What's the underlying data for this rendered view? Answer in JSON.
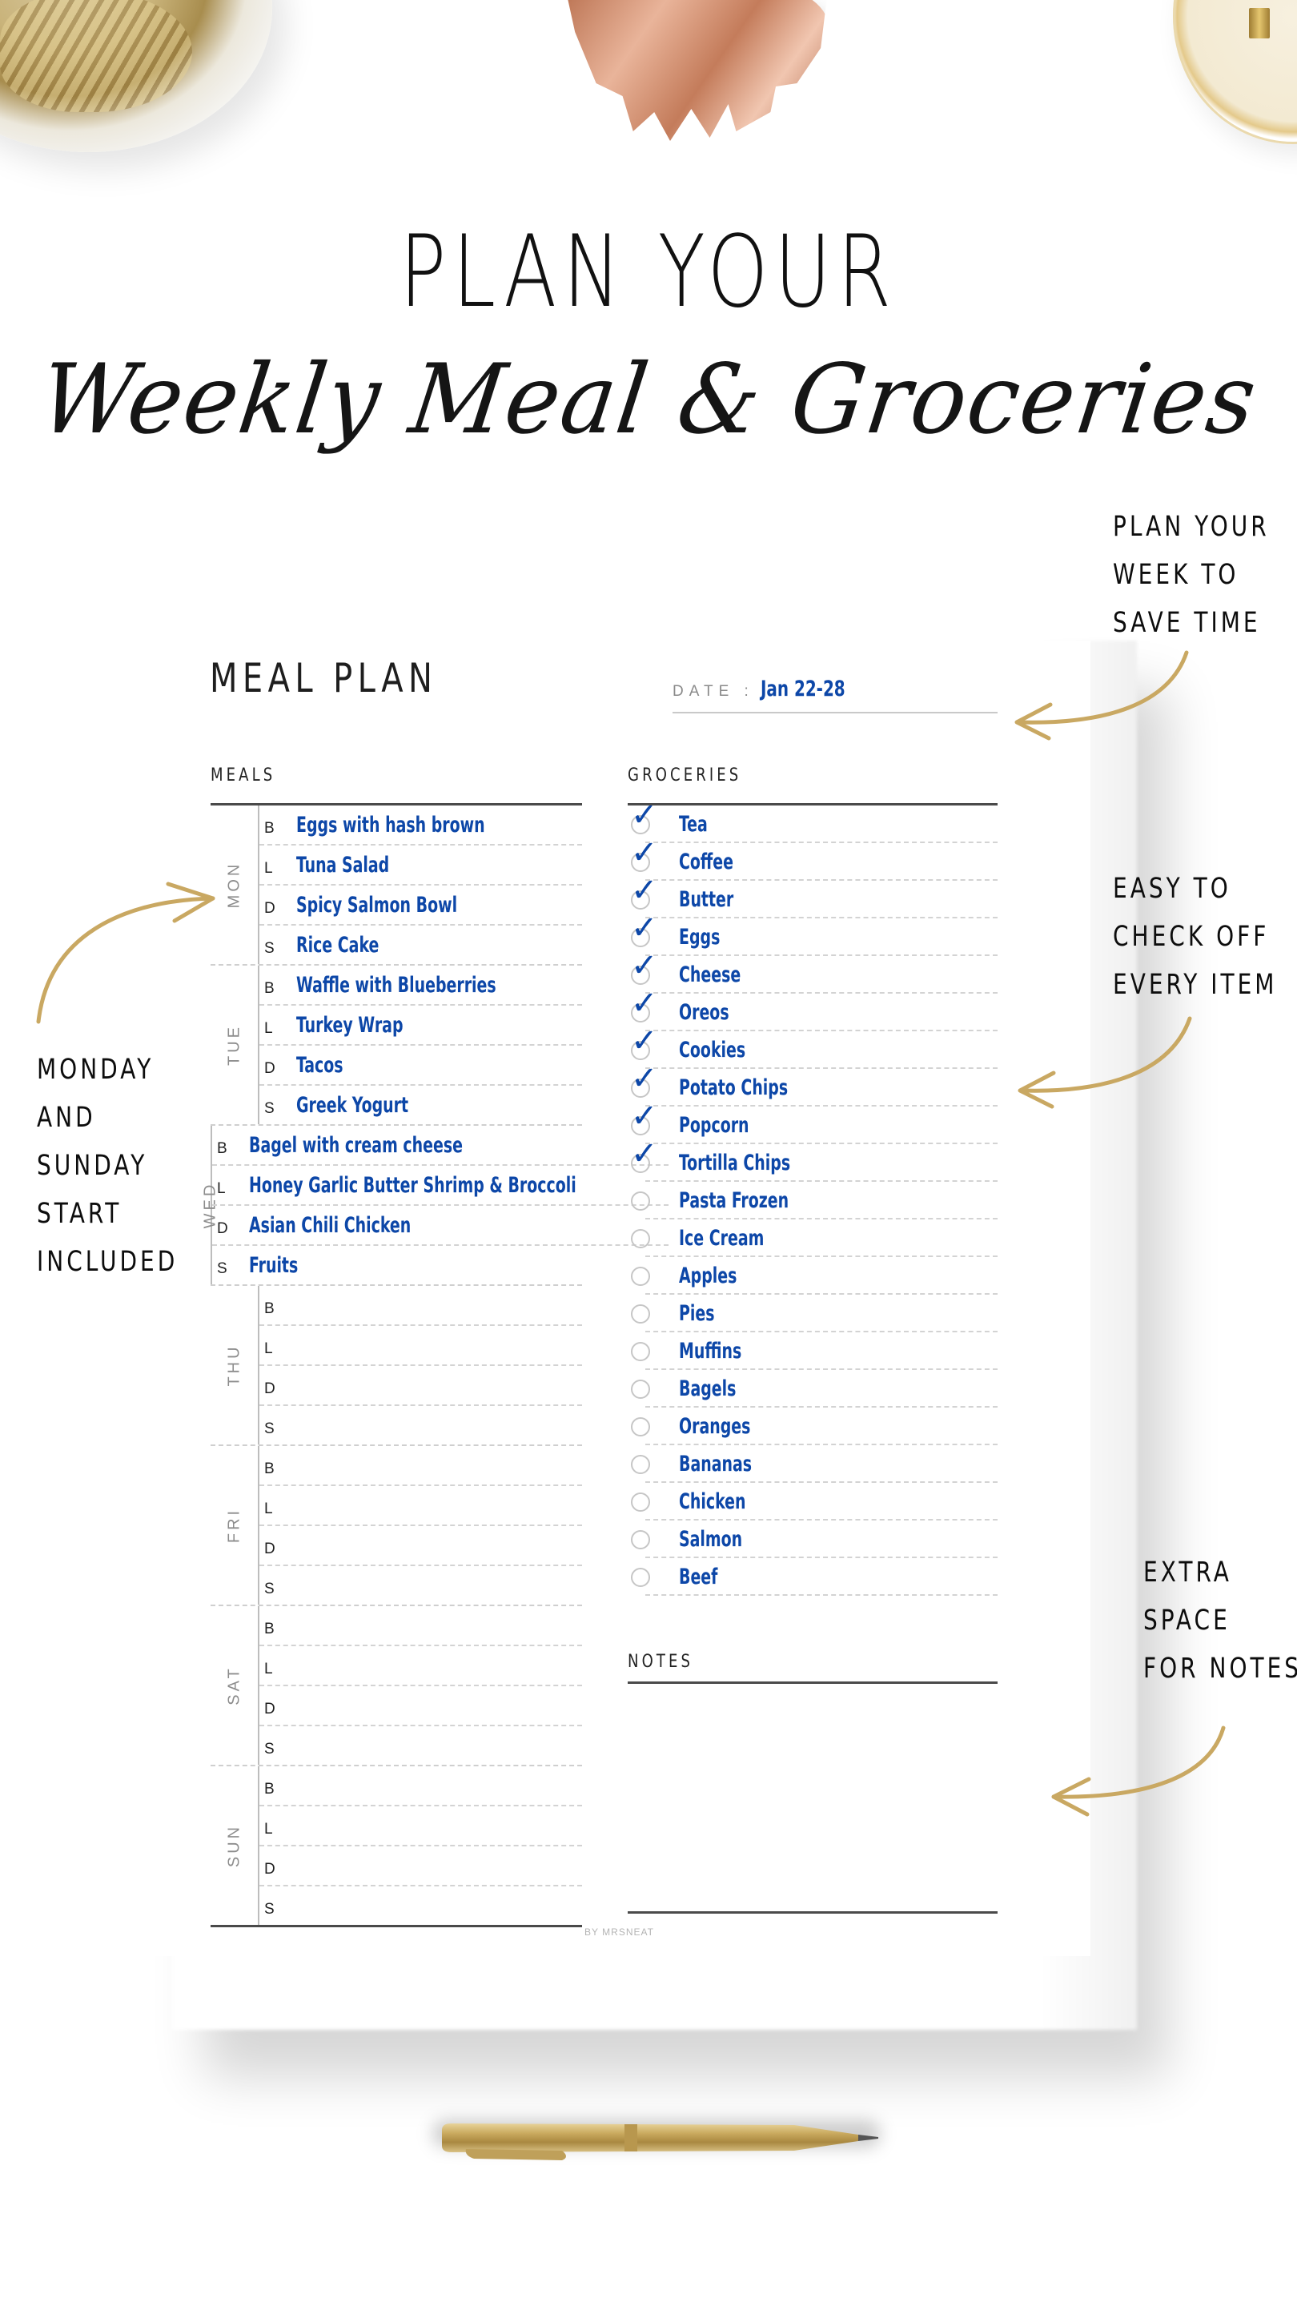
{
  "hero": {
    "title": "PLAN YOUR",
    "script_subtitle": "Weekly Meal & Groceries"
  },
  "planner": {
    "title": "MEAL PLAN",
    "date_label": "DATE :",
    "date_value": "Jan 22-28",
    "meals_label": "MEALS",
    "groceries_label": "GROCERIES",
    "notes_label": "NOTES",
    "credit": "BY MRSNEAT",
    "accent_color": "#0d47a8",
    "days": [
      {
        "day": "MON",
        "slots": [
          {
            "letter": "B",
            "meal": "Eggs with hash brown"
          },
          {
            "letter": "L",
            "meal": "Tuna Salad"
          },
          {
            "letter": "D",
            "meal": "Spicy Salmon Bowl"
          },
          {
            "letter": "S",
            "meal": "Rice Cake"
          }
        ]
      },
      {
        "day": "TUE",
        "slots": [
          {
            "letter": "B",
            "meal": "Waffle with Blueberries"
          },
          {
            "letter": "L",
            "meal": "Turkey Wrap"
          },
          {
            "letter": "D",
            "meal": "Tacos"
          },
          {
            "letter": "S",
            "meal": "Greek Yogurt"
          }
        ]
      },
      {
        "day": "WED",
        "slots": [
          {
            "letter": "B",
            "meal": "Bagel with cream cheese"
          },
          {
            "letter": "L",
            "meal": "Honey Garlic Butter Shrimp & Broccoli"
          },
          {
            "letter": "D",
            "meal": "Asian Chili Chicken"
          },
          {
            "letter": "S",
            "meal": "Fruits"
          }
        ]
      },
      {
        "day": "THU",
        "slots": [
          {
            "letter": "B",
            "meal": ""
          },
          {
            "letter": "L",
            "meal": ""
          },
          {
            "letter": "D",
            "meal": ""
          },
          {
            "letter": "S",
            "meal": ""
          }
        ]
      },
      {
        "day": "FRI",
        "slots": [
          {
            "letter": "B",
            "meal": ""
          },
          {
            "letter": "L",
            "meal": ""
          },
          {
            "letter": "D",
            "meal": ""
          },
          {
            "letter": "S",
            "meal": ""
          }
        ]
      },
      {
        "day": "SAT",
        "slots": [
          {
            "letter": "B",
            "meal": ""
          },
          {
            "letter": "L",
            "meal": ""
          },
          {
            "letter": "D",
            "meal": ""
          },
          {
            "letter": "S",
            "meal": ""
          }
        ]
      },
      {
        "day": "SUN",
        "slots": [
          {
            "letter": "B",
            "meal": ""
          },
          {
            "letter": "L",
            "meal": ""
          },
          {
            "letter": "D",
            "meal": ""
          },
          {
            "letter": "S",
            "meal": ""
          }
        ]
      }
    ],
    "groceries": [
      {
        "item": "Tea",
        "checked": true
      },
      {
        "item": "Coffee",
        "checked": true
      },
      {
        "item": "Butter",
        "checked": true
      },
      {
        "item": "Eggs",
        "checked": true
      },
      {
        "item": "Cheese",
        "checked": true
      },
      {
        "item": "Oreos",
        "checked": true
      },
      {
        "item": "Cookies",
        "checked": true
      },
      {
        "item": "Potato Chips",
        "checked": true
      },
      {
        "item": "Popcorn",
        "checked": true
      },
      {
        "item": "Tortilla Chips",
        "checked": true
      },
      {
        "item": "Pasta Frozen",
        "checked": false
      },
      {
        "item": "Ice Cream",
        "checked": false
      },
      {
        "item": "Apples",
        "checked": false
      },
      {
        "item": "Pies",
        "checked": false
      },
      {
        "item": "Muffins",
        "checked": false
      },
      {
        "item": "Bagels",
        "checked": false
      },
      {
        "item": "Oranges",
        "checked": false
      },
      {
        "item": "Bananas",
        "checked": false
      },
      {
        "item": "Chicken",
        "checked": false
      },
      {
        "item": "Salmon",
        "checked": false
      },
      {
        "item": "Beef",
        "checked": false
      }
    ],
    "check_glyph": "✓"
  },
  "callouts": {
    "plan_week": [
      "PLAN YOUR",
      "WEEK TO",
      "SAVE TIME"
    ],
    "check_off": [
      "EASY TO",
      "CHECK OFF",
      "EVERY ITEM"
    ],
    "start_day": [
      "MONDAY",
      "AND",
      "SUNDAY",
      "START",
      "INCLUDED"
    ],
    "notes_space": [
      "EXTRA",
      "SPACE",
      "FOR NOTES"
    ]
  },
  "decor": {
    "arrow_color": "#c9a862",
    "icons": [
      "binder-clips-bowl",
      "copper-monstera-leaf",
      "gold-dish",
      "gold-pen",
      "gold-arrow"
    ]
  }
}
